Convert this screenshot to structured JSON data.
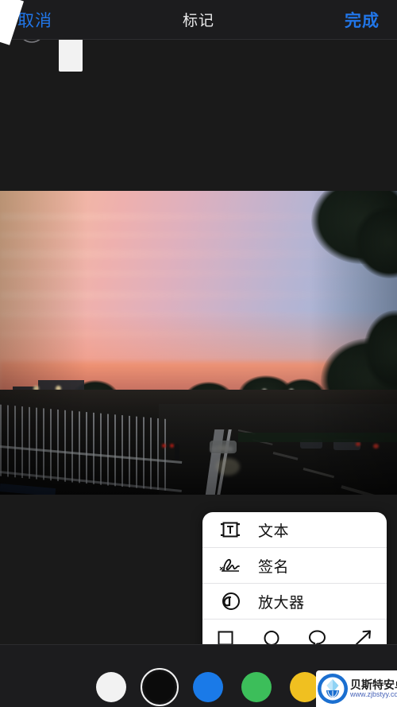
{
  "navbar": {
    "cancel_label": "取消",
    "title": "标记",
    "done_label": "完成",
    "accent_color": "#2176e8",
    "title_color": "#e9e9ea",
    "background": "#1c1c1e"
  },
  "photo": {
    "description": "城市日落街景照片",
    "scene": "sunset city street with road, fence, buildings, trees and traffic lights"
  },
  "popup_menu": {
    "items": [
      {
        "label": "文本",
        "icon": "text-box-icon"
      },
      {
        "label": "签名",
        "icon": "signature-icon"
      },
      {
        "label": "放大器",
        "icon": "magnifier-icon"
      }
    ],
    "shapes": [
      {
        "name": "square-shape-icon"
      },
      {
        "name": "circle-shape-icon"
      },
      {
        "name": "speech-bubble-shape-icon"
      },
      {
        "name": "arrow-shape-icon"
      }
    ],
    "background": "#ffffff"
  },
  "toolbar": {
    "undo_icon": "undo-icon",
    "pen_tool": "pen-marker-tool",
    "background": "#1c1c1e",
    "colors": [
      {
        "name": "white",
        "hex": "#f2f2f2",
        "selected": false
      },
      {
        "name": "black",
        "hex": "#0b0b0b",
        "selected": true
      },
      {
        "name": "blue",
        "hex": "#1a7ae8",
        "selected": false
      },
      {
        "name": "green",
        "hex": "#3cbe5a",
        "selected": false
      },
      {
        "name": "yellow",
        "hex": "#f0c020",
        "selected": false
      },
      {
        "name": "red",
        "hex": "#ef3248",
        "selected": false
      }
    ]
  },
  "watermark": {
    "title": "贝斯特安卓网",
    "url": "www.zjbstyy.com",
    "logo_color": "#1b6fd0"
  }
}
